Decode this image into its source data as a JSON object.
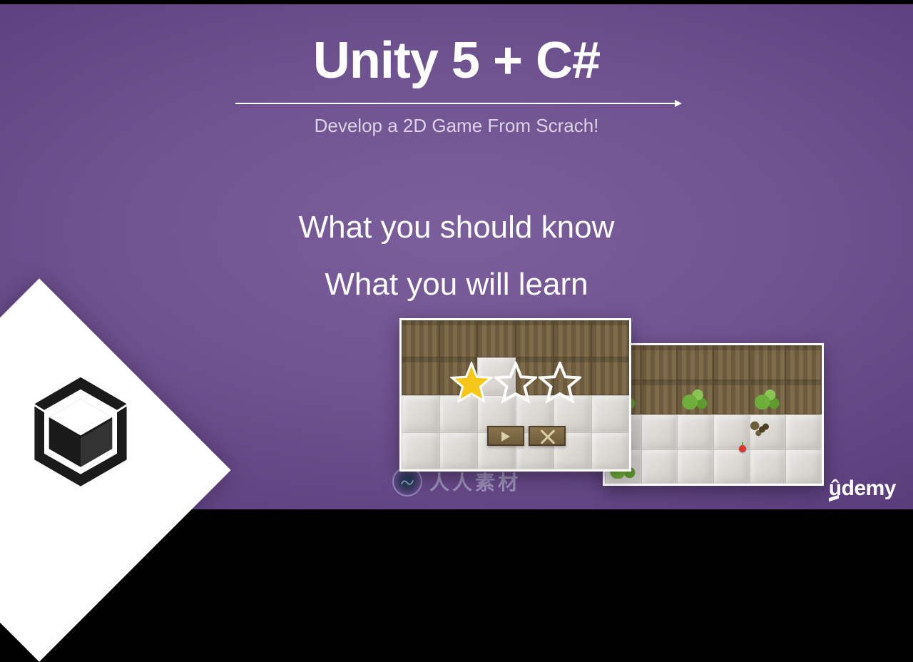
{
  "title": "Unity 5 + C#",
  "subtitle": "Develop a 2D Game From Scrach!",
  "line1": "What you should know",
  "line2": "What you will learn",
  "watermark_text": "人人素材",
  "brand": "ûdemy",
  "icons": {
    "unity_logo": "unity-logo-icon",
    "star_filled": "star-filled-icon",
    "star_outline": "star-outline-icon",
    "watermark_badge": "watermark-badge-icon"
  },
  "screenshots": {
    "shot1": {
      "stars": [
        true,
        false,
        false
      ]
    },
    "shot2": {}
  }
}
